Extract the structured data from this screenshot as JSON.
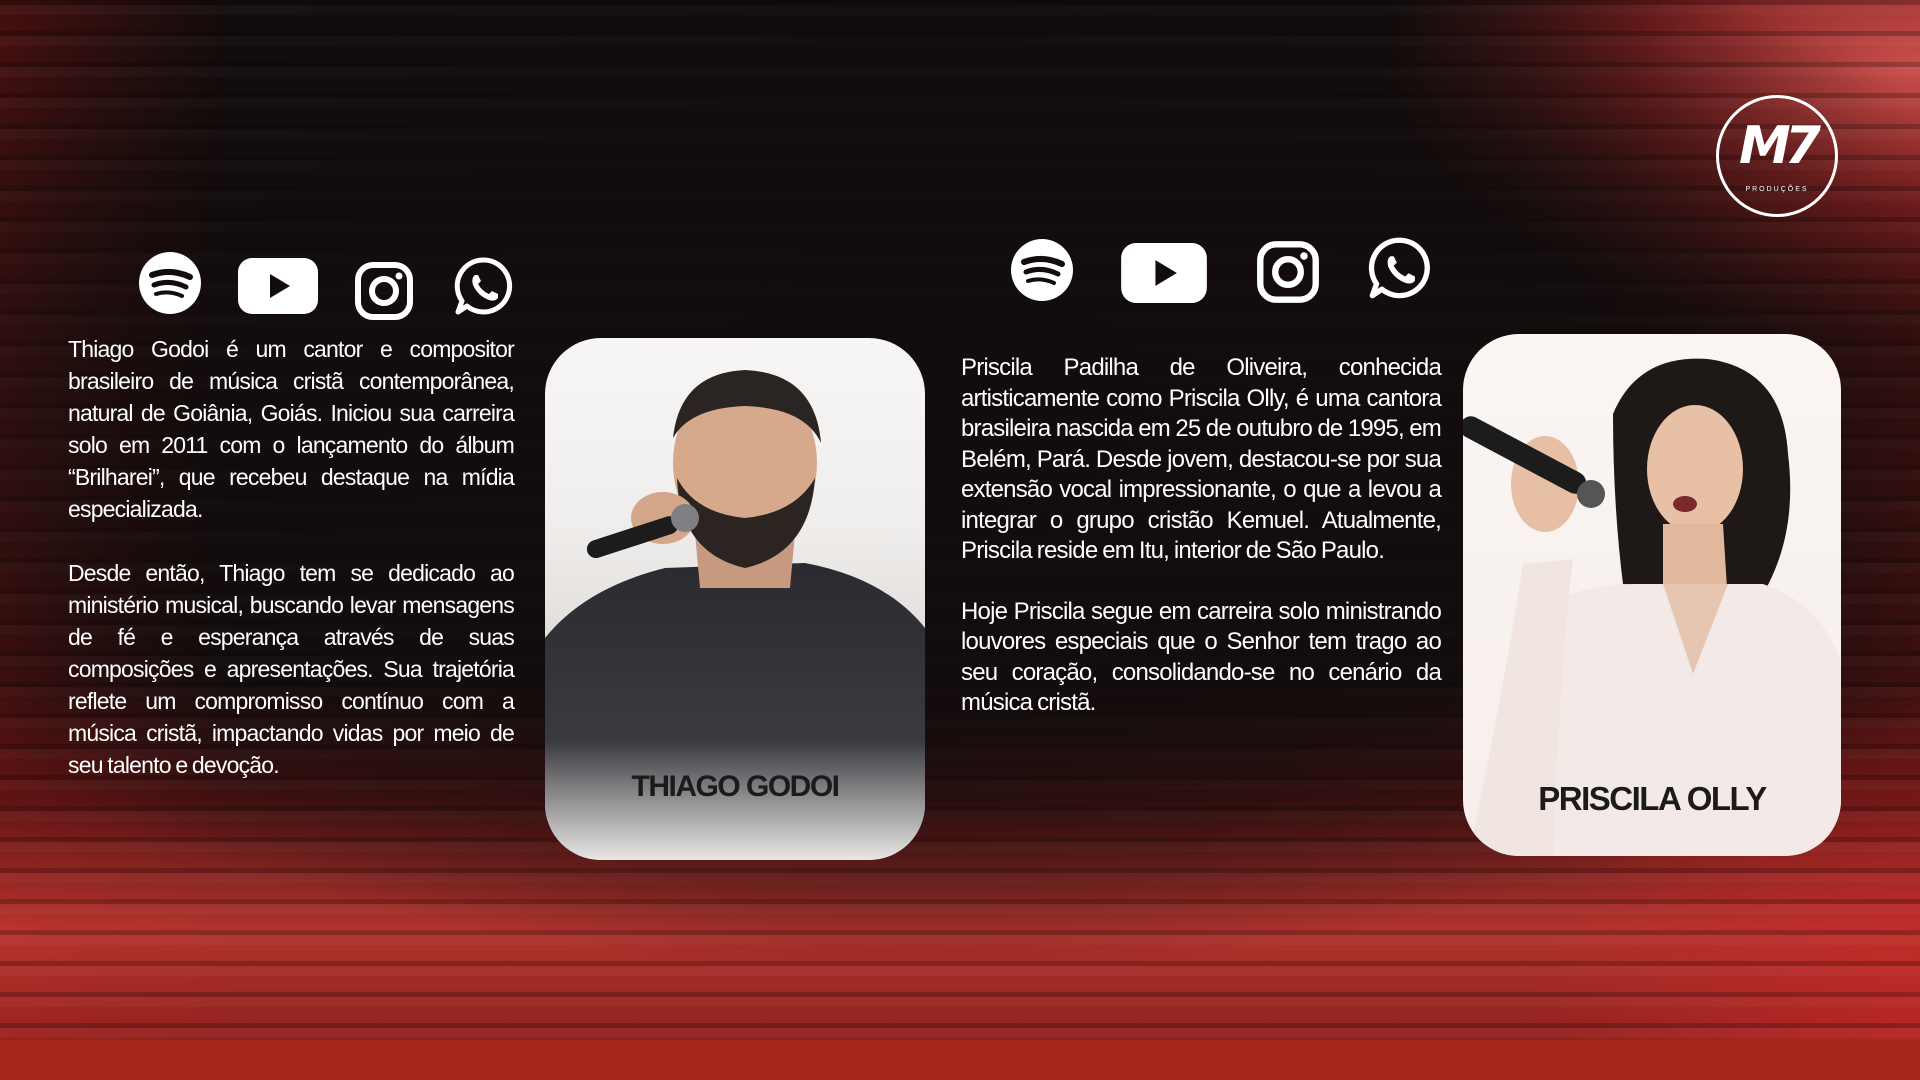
{
  "logo": {
    "mark": "M7",
    "subtitle": "PRODUÇÕES"
  },
  "artists": [
    {
      "name": "THIAGO GODOI",
      "social_icons": [
        "spotify-icon",
        "youtube-icon",
        "instagram-icon",
        "whatsapp-icon"
      ],
      "bio": [
        "Thiago Godoi é um cantor e compositor brasileiro de música cristã contemporânea, natural de Goiânia, Goiás. Iniciou sua carreira solo em 2011 com o lançamento do álbum “Brilharei”, que recebeu destaque na mídia especializada.",
        "Desde então, Thiago tem se dedicado ao ministério musical, buscando levar mensagens de fé e esperança através de suas composições e apresentações. Sua trajetória reflete um compromisso contínuo com a música cristã, impactando vidas por meio de seu talento e devoção."
      ]
    },
    {
      "name": "PRISCILA OLLY",
      "social_icons": [
        "spotify-icon",
        "youtube-icon",
        "instagram-icon",
        "whatsapp-icon"
      ],
      "bio": [
        "Priscila Padilha de Oliveira, conhecida artisticamente como Priscila Olly, é uma cantora brasileira nascida em 25 de outubro de 1995, em Belém, Pará. Desde jovem, destacou-se por sua extensão vocal impressionante, o que a levou a integrar o grupo cristão Kemuel. Atualmente, Priscila reside em Itu, interior de São Paulo.",
        "Hoje Priscila segue em carreira solo ministrando louvores especiais que o Senhor tem trago ao seu coração, consolidando-se no cenário da música cristã."
      ]
    }
  ],
  "colors": {
    "background": "#120c0c",
    "accent_red": "#a4261c",
    "text": "#ffffff",
    "card": "#f4f2f0"
  }
}
